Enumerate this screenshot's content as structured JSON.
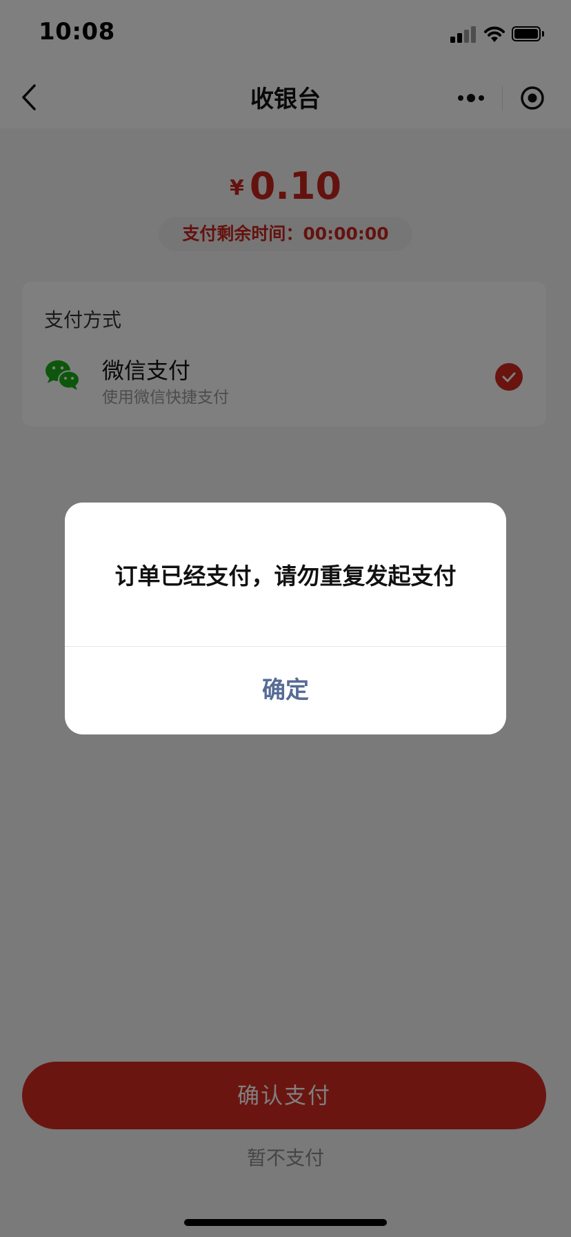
{
  "status_bar": {
    "time": "10:08"
  },
  "navbar": {
    "title": "收银台"
  },
  "payment": {
    "currency_symbol": "¥",
    "amount": "0.10",
    "countdown": "支付剩余时间：00:00:00"
  },
  "method_card": {
    "title": "支付方式",
    "method_name": "微信支付",
    "method_desc": "使用微信快捷支付"
  },
  "actions": {
    "confirm_label": "确认支付",
    "skip_label": "暂不支付"
  },
  "dialog": {
    "message": "订单已经支付，请勿重复发起支付",
    "ok_label": "确定"
  },
  "colors": {
    "accent_red": "#d62a20",
    "dialog_link": "#576b95",
    "wechat_green": "#1aad19"
  }
}
